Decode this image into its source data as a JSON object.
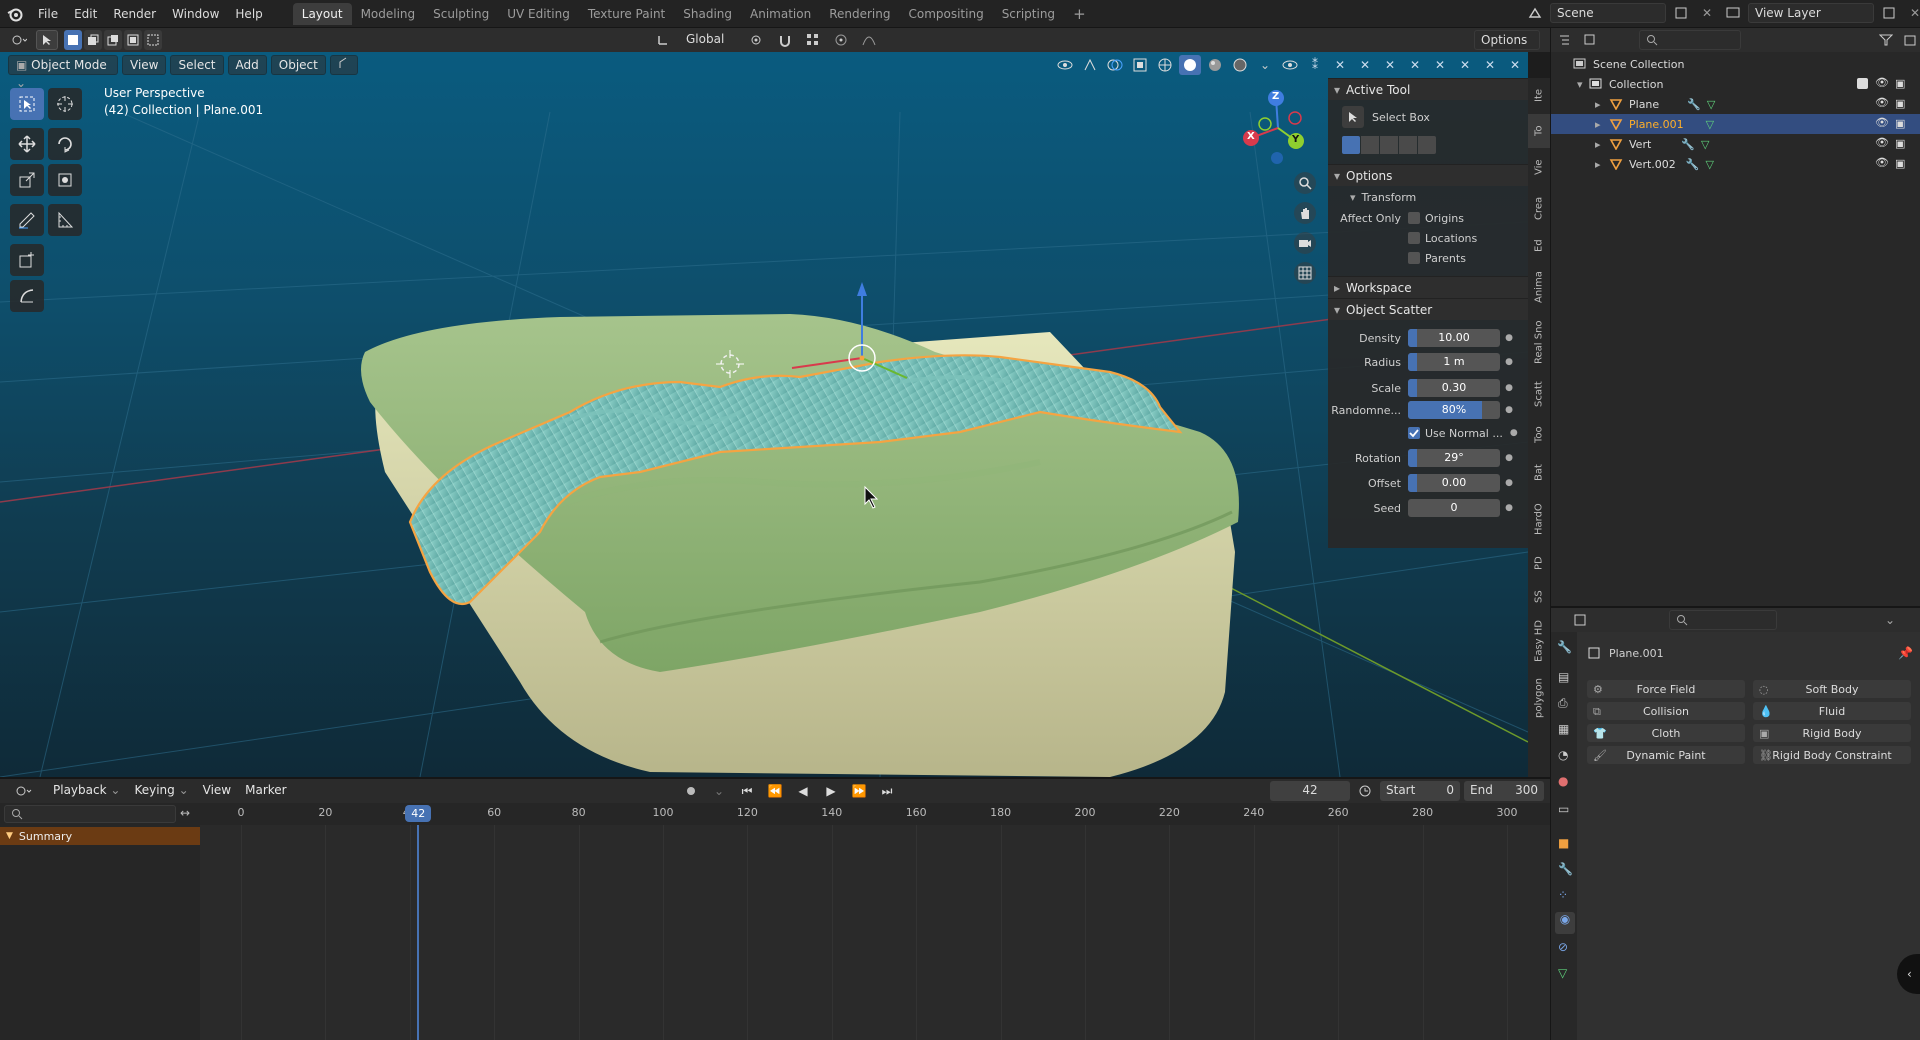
{
  "menu": {
    "file": "File",
    "edit": "Edit",
    "render": "Render",
    "window": "Window",
    "help": "Help"
  },
  "workspaces": [
    "Layout",
    "Modeling",
    "Sculpting",
    "UV Editing",
    "Texture Paint",
    "Shading",
    "Animation",
    "Rendering",
    "Compositing",
    "Scripting"
  ],
  "active_workspace": "Layout",
  "scene": {
    "label": "Scene",
    "view_layer": "View Layer"
  },
  "toolbar": {
    "orientation": "Global",
    "options": "Options"
  },
  "viewport": {
    "mode": "Object Mode",
    "view": "View",
    "select": "Select",
    "add": "Add",
    "object": "Object",
    "info_line1": "User Perspective",
    "info_line2": "(42) Collection | Plane.001",
    "gizmo": {
      "x": "X",
      "y": "Y",
      "z": "Z"
    }
  },
  "npanel": {
    "active_tool": "Active Tool",
    "select_box": "Select Box",
    "options": "Options",
    "transform": "Transform",
    "affect_only": "Affect Only",
    "origins": "Origins",
    "locations": "Locations",
    "parents": "Parents",
    "workspace": "Workspace",
    "object_scatter": "Object Scatter",
    "density_label": "Density",
    "density": "10.00",
    "radius_label": "Radius",
    "radius": "1 m",
    "scale_label": "Scale",
    "scale": "0.30",
    "randomness_label": "Randomne...",
    "randomness": "80%",
    "randomness_fraction": 0.8,
    "use_normal": "Use Normal ...",
    "rotation_label": "Rotation",
    "rotation": "29°",
    "offset_label": "Offset",
    "offset": "0.00",
    "seed_label": "Seed",
    "seed": "0"
  },
  "side_tabs": [
    "Ite",
    "To",
    "Vie",
    "Crea",
    "Ed",
    "Anima",
    "Real Sno",
    "Scatt",
    "Too",
    "Bat",
    "HardO",
    "PD",
    "SS",
    "Easy HD",
    "polygon"
  ],
  "outliner": {
    "scene_collection": "Scene Collection",
    "collection": "Collection",
    "items": [
      "Plane",
      "Plane.001",
      "Vert",
      "Vert.002"
    ],
    "selected": "Plane.001"
  },
  "properties": {
    "object_name": "Plane.001",
    "physics": {
      "force_field": "Force Field",
      "soft_body": "Soft Body",
      "collision": "Collision",
      "fluid": "Fluid",
      "cloth": "Cloth",
      "rigid_body": "Rigid Body",
      "dynamic_paint": "Dynamic Paint",
      "rigid_body_constraint": "Rigid Body Constraint"
    }
  },
  "timeline": {
    "playback": "Playback",
    "keying": "Keying",
    "view": "View",
    "marker": "Marker",
    "current_frame": "42",
    "start_label": "Start",
    "start": "0",
    "end_label": "End",
    "end": "300",
    "ticks": [
      "0",
      "20",
      "40",
      "60",
      "80",
      "100",
      "120",
      "140",
      "160",
      "180",
      "200",
      "220",
      "240",
      "260",
      "280",
      "300"
    ],
    "summary": "Summary"
  },
  "colors": {
    "accent": "#4772b3",
    "selection": "#f5a442",
    "active_text": "#ffaf29",
    "viewport_top": "#0a5b7f"
  }
}
